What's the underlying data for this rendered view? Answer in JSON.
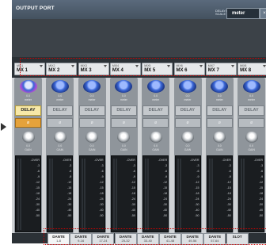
{
  "window": {
    "title": "OUTPUT PORT",
    "delay_scale_label": "DELAY/ SCALE",
    "delay_scale_value": "meter"
  },
  "mix_buttons": [
    {
      "small": "MIX1",
      "label": "MX 1"
    },
    {
      "small": "MIX2",
      "label": "MX 2"
    },
    {
      "small": "MIX3",
      "label": "MX 3"
    },
    {
      "small": "MIX4",
      "label": "MX 4"
    },
    {
      "small": "MIX5",
      "label": "MX 5"
    },
    {
      "small": "MIX6",
      "label": "MX 6"
    },
    {
      "small": "MIX7",
      "label": "MX 7"
    },
    {
      "small": "MIX8",
      "label": "MX 8"
    }
  ],
  "channels": {
    "delay_value": "0.0",
    "delay_unit": "meter",
    "delay_label": "DELAY",
    "phase_label": "ø",
    "gain_value": "0.0",
    "gain_unit": "GAIN",
    "meter_scale": [
      "-OVER",
      "-3",
      "-6",
      "-9",
      "-12",
      "-15",
      "-18",
      "-24",
      "-30",
      "-40",
      "-50"
    ]
  },
  "dante_tabs": [
    {
      "a": "DANTE",
      "b": "1-8"
    },
    {
      "a": "DANTE",
      "b": "9-16"
    },
    {
      "a": "DANTE",
      "b": "17-24"
    },
    {
      "a": "DANTE",
      "b": "25-32"
    },
    {
      "a": "DANTE",
      "b": "33-40"
    },
    {
      "a": "DANTE",
      "b": "41-48"
    },
    {
      "a": "DANTE",
      "b": "49-56"
    },
    {
      "a": "DANTE",
      "b": "57-64"
    },
    {
      "a": "SLOT",
      "b": ""
    }
  ]
}
